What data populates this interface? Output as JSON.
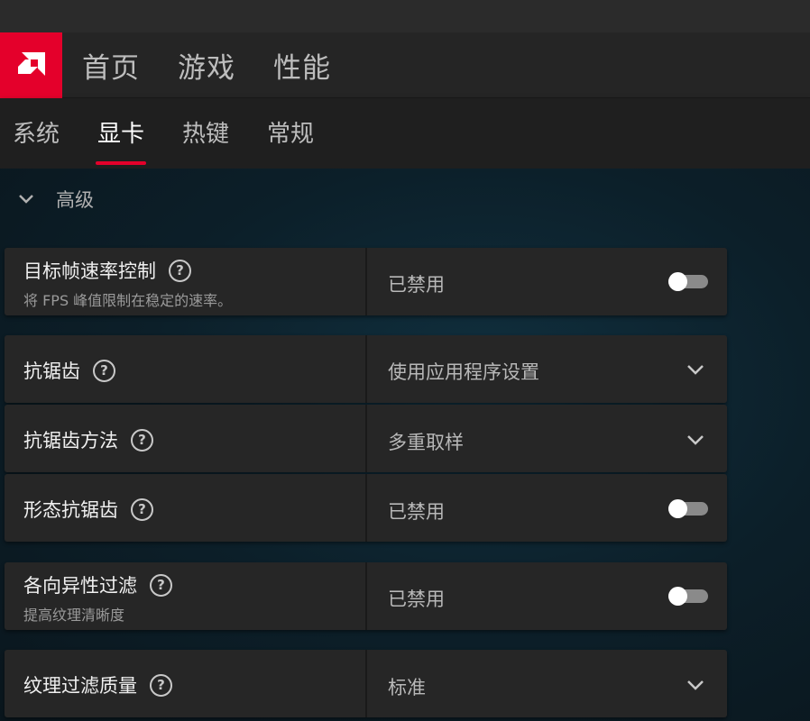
{
  "header": {
    "logo_icon": "amd-logo-icon",
    "accent_color": "#e4002b",
    "nav": [
      "首页",
      "游戏",
      "性能"
    ]
  },
  "subnav": {
    "tabs": [
      "系统",
      "显卡",
      "热键",
      "常规"
    ],
    "active": "显卡"
  },
  "section": {
    "label": "高级",
    "icon": "chevron-down-icon"
  },
  "settings": [
    {
      "title": "目标帧速率控制",
      "description": "将 FPS 峰值限制在稳定的速率。",
      "value": "已禁用",
      "control": "toggle",
      "state": "off"
    },
    {
      "title": "抗锯齿",
      "value": "使用应用程序设置",
      "control": "dropdown"
    },
    {
      "title": "抗锯齿方法",
      "value": "多重取样",
      "control": "dropdown"
    },
    {
      "title": "形态抗锯齿",
      "value": "已禁用",
      "control": "toggle",
      "state": "off"
    },
    {
      "title": "各向异性过滤",
      "description": "提高纹理清晰度",
      "value": "已禁用",
      "control": "toggle",
      "state": "off"
    },
    {
      "title": "纹理过滤质量",
      "value": "标准",
      "control": "dropdown"
    }
  ],
  "help_glyph": "?"
}
